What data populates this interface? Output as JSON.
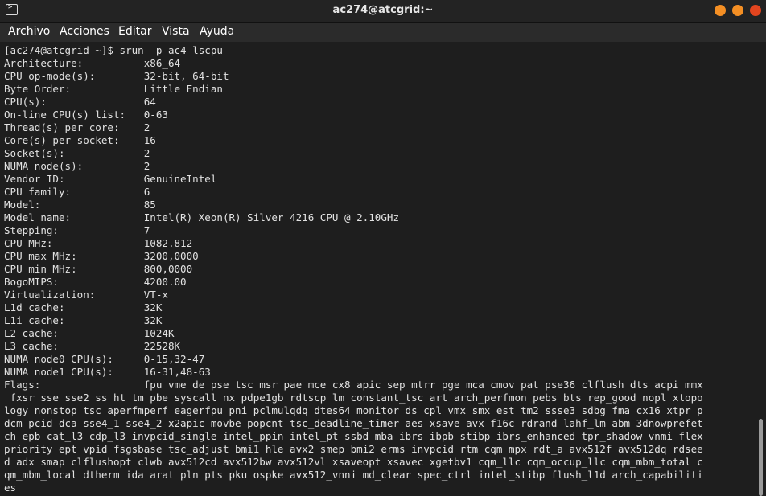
{
  "window": {
    "title": "ac274@atcgrid:~",
    "icon": "terminal-icon",
    "buttons": [
      {
        "name": "minimize",
        "color": "#f48f24"
      },
      {
        "name": "maximize",
        "color": "#f48f24"
      },
      {
        "name": "close",
        "color": "#e3451f"
      }
    ]
  },
  "menu": {
    "items": [
      "Archivo",
      "Acciones",
      "Editar",
      "Vista",
      "Ayuda"
    ]
  },
  "terminal": {
    "lines": [
      "[ac274@atcgrid ~]$ srun -p ac4 lscpu",
      "Architecture:          x86_64",
      "CPU op-mode(s):        32-bit, 64-bit",
      "Byte Order:            Little Endian",
      "CPU(s):                64",
      "On-line CPU(s) list:   0-63",
      "Thread(s) per core:    2",
      "Core(s) per socket:    16",
      "Socket(s):             2",
      "NUMA node(s):          2",
      "Vendor ID:             GenuineIntel",
      "CPU family:            6",
      "Model:                 85",
      "Model name:            Intel(R) Xeon(R) Silver 4216 CPU @ 2.10GHz",
      "Stepping:              7",
      "CPU MHz:               1082.812",
      "CPU max MHz:           3200,0000",
      "CPU min MHz:           800,0000",
      "BogoMIPS:              4200.00",
      "Virtualization:        VT-x",
      "L1d cache:             32K",
      "L1i cache:             32K",
      "L2 cache:              1024K",
      "L3 cache:              22528K",
      "NUMA node0 CPU(s):     0-15,32-47",
      "NUMA node1 CPU(s):     16-31,48-63",
      "Flags:                 fpu vme de pse tsc msr pae mce cx8 apic sep mtrr pge mca cmov pat pse36 clflush dts acpi mmx",
      " fxsr sse sse2 ss ht tm pbe syscall nx pdpe1gb rdtscp lm constant_tsc art arch_perfmon pebs bts rep_good nopl xtopo",
      "logy nonstop_tsc aperfmperf eagerfpu pni pclmulqdq dtes64 monitor ds_cpl vmx smx est tm2 ssse3 sdbg fma cx16 xtpr p",
      "dcm pcid dca sse4_1 sse4_2 x2apic movbe popcnt tsc_deadline_timer aes xsave avx f16c rdrand lahf_lm abm 3dnowprefet",
      "ch epb cat_l3 cdp_l3 invpcid_single intel_ppin intel_pt ssbd mba ibrs ibpb stibp ibrs_enhanced tpr_shadow vnmi flex",
      "priority ept vpid fsgsbase tsc_adjust bmi1 hle avx2 smep bmi2 erms invpcid rtm cqm mpx rdt_a avx512f avx512dq rdsee",
      "d adx smap clflushopt clwb avx512cd avx512bw avx512vl xsaveopt xsavec xgetbv1 cqm_llc cqm_occup_llc cqm_mbm_total c",
      "qm_mbm_local dtherm ida arat pln pts pku ospke avx512_vnni md_clear spec_ctrl intel_stibp flush_l1d arch_capabiliti",
      "es"
    ]
  }
}
